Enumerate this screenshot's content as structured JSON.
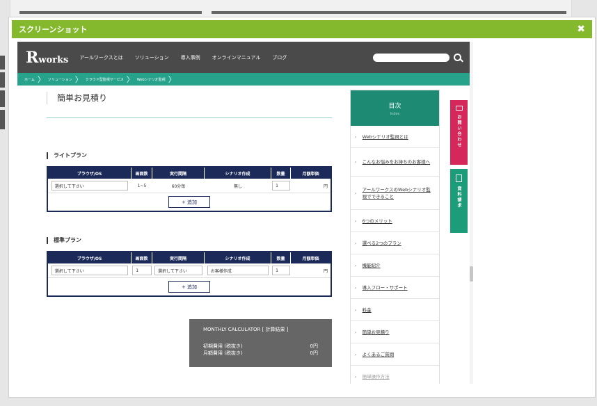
{
  "modal": {
    "title": "スクリーンショット",
    "close": "✖"
  },
  "nav": {
    "logo": "works",
    "logo_initial": "R",
    "items": [
      "アールワークスとは",
      "ソリューション",
      "導入事例",
      "オンラインマニュアル",
      "ブログ"
    ]
  },
  "breadcrumb": [
    "ホーム",
    "ソリューション",
    "クラウド型監視サービス",
    "Webシナリオ監視"
  ],
  "page": {
    "title": "簡単お見積り"
  },
  "light_plan": {
    "title": "ライトプラン",
    "headers": [
      "ブラウザ/OS",
      "画面数",
      "実行間隔",
      "シナリオ作成",
      "数量",
      "月額単価"
    ],
    "row": {
      "browser": "選択して下さい",
      "screens": "1~5",
      "interval": "60分毎",
      "scenario": "無し",
      "qty": "1",
      "unit": "円"
    },
    "add": "+ 追加"
  },
  "standard_plan": {
    "title": "標準プラン",
    "headers": [
      "ブラウザ/OS",
      "画面数",
      "実行間隔",
      "シナリオ作成",
      "数量",
      "月額単価"
    ],
    "row": {
      "browser": "選択して下さい",
      "screens": "1",
      "interval": "選択して下さい",
      "scenario": "お客様作成",
      "qty": "1",
      "unit": "円"
    },
    "add": "+ 追加"
  },
  "calculator": {
    "title": "MONTHLY CALCULATOR [ 計算結果 ]",
    "initial_label": "初期費用 (税抜き)",
    "initial_value": "0円",
    "monthly_label": "月額費用 (税抜き)",
    "monthly_value": "0円"
  },
  "toc": {
    "title": "目次",
    "subtitle": "Index",
    "items": [
      "Webシナリオ監視とは",
      "こんなお悩みをお持ちのお客様へ",
      "アールワークスのWebシナリオ監視でできること",
      "6つのメリット",
      "選べる2つのプラン",
      "機能紹介",
      "導入フロー・サポート",
      "料金",
      "簡単お見積り",
      "よくあるご質問",
      "簡単操作方法"
    ]
  },
  "side_tabs": {
    "contact": "お問い合わせ",
    "docs": "資料請求"
  },
  "colors": {
    "header": "#84b82d",
    "nav": "#4a4a4a",
    "breadcrumb": "#27a38c",
    "navy": "#1b2a58",
    "contact": "#d6275a",
    "docs": "#1d9c79"
  }
}
